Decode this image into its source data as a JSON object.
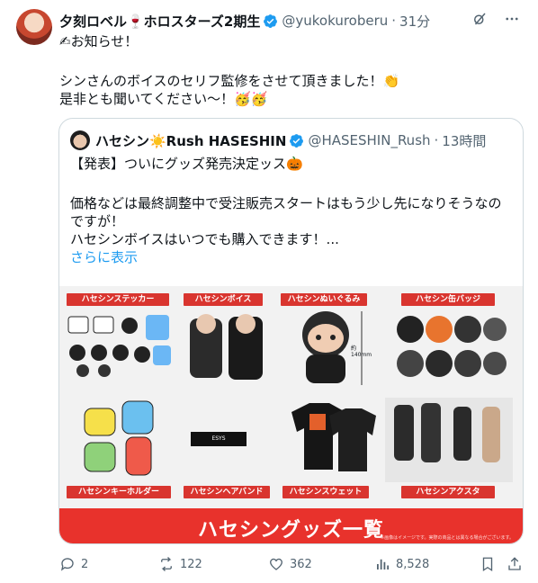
{
  "author": {
    "display_name": "夕刻ロベル🍷ホロスターズ2期生",
    "handle": "@yukokuroberu",
    "separator": "·",
    "time": "31分"
  },
  "post": {
    "lines": [
      "✍お知らせ！",
      "",
      "シンさんのボイスのセリフ監修をさせて頂きました！👏",
      "是非とも聞いてください〜！🥳🥳"
    ]
  },
  "quote": {
    "display_name": "ハセシン☀️Rush HASESHIN",
    "handle": "@HASESHIN_Rush",
    "separator": "·",
    "time": "13時間",
    "lines": [
      "【発表】ついにグッズ発売決定ッス🎃",
      "",
      "価格などは最終調整中で受注販売スタートはもう少し先になりそうなの",
      "ですが！",
      "ハセシンボイスはいつでも購入できます！..."
    ],
    "show_more": "さらに表示",
    "image": {
      "labels": {
        "sticker": "ハセシンステッカー",
        "voice": "ハセシンボイス",
        "plush": "ハセシンぬいぐるみ",
        "badge": "ハセシン缶バッジ",
        "keyholder": "ハセシンキーホルダー",
        "hairband": "ハセシンヘアバンド",
        "sweat": "ハセシンスウェット",
        "acrylic": "ハセシンアクスタ"
      },
      "plush_size": "約140mm",
      "hairband_text": "ESYS",
      "banner": "ハセシングッズ一覧",
      "note": "※画像はイメージです。実際の商品とは異なる場合がございます。"
    }
  },
  "actions": {
    "replies": "2",
    "reposts": "122",
    "likes": "362",
    "views": "8,528"
  },
  "colors": {
    "accent": "#1d9bf0",
    "promo_red": "#e8322c",
    "text_secondary": "#536471"
  }
}
